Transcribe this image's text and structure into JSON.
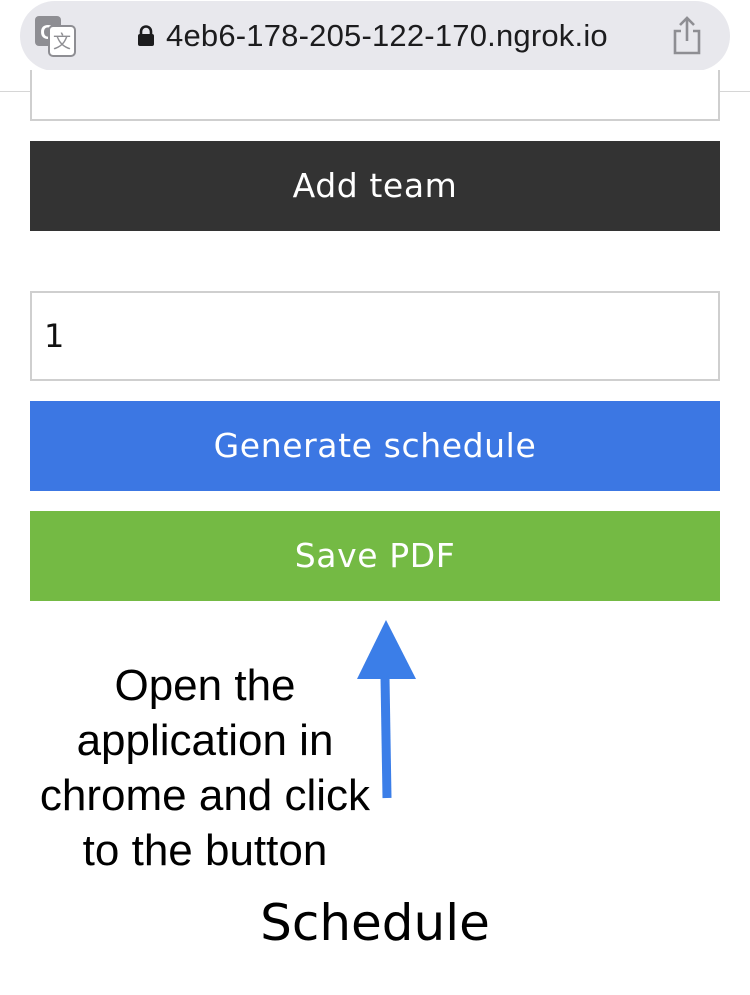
{
  "browser": {
    "url": "4eb6-178-205-122-170.ngrok.io",
    "icons": [
      "translate-icon",
      "lock-icon",
      "share-icon"
    ],
    "pill_color": "#e8e8ed"
  },
  "form": {
    "top_input_value": "",
    "add_team_label": "Add team",
    "number_value": "1",
    "generate_label": "Generate schedule",
    "save_pdf_label": "Save PDF"
  },
  "annotation": {
    "instruction_lines": [
      "Open the",
      "application in",
      "chrome and click",
      "to the button"
    ],
    "title": "Schedule",
    "arrow_color": "#3b7ee8"
  },
  "colors": {
    "add_team": "#333333",
    "generate": "#3c77e3",
    "save_pdf": "#74ba44"
  }
}
